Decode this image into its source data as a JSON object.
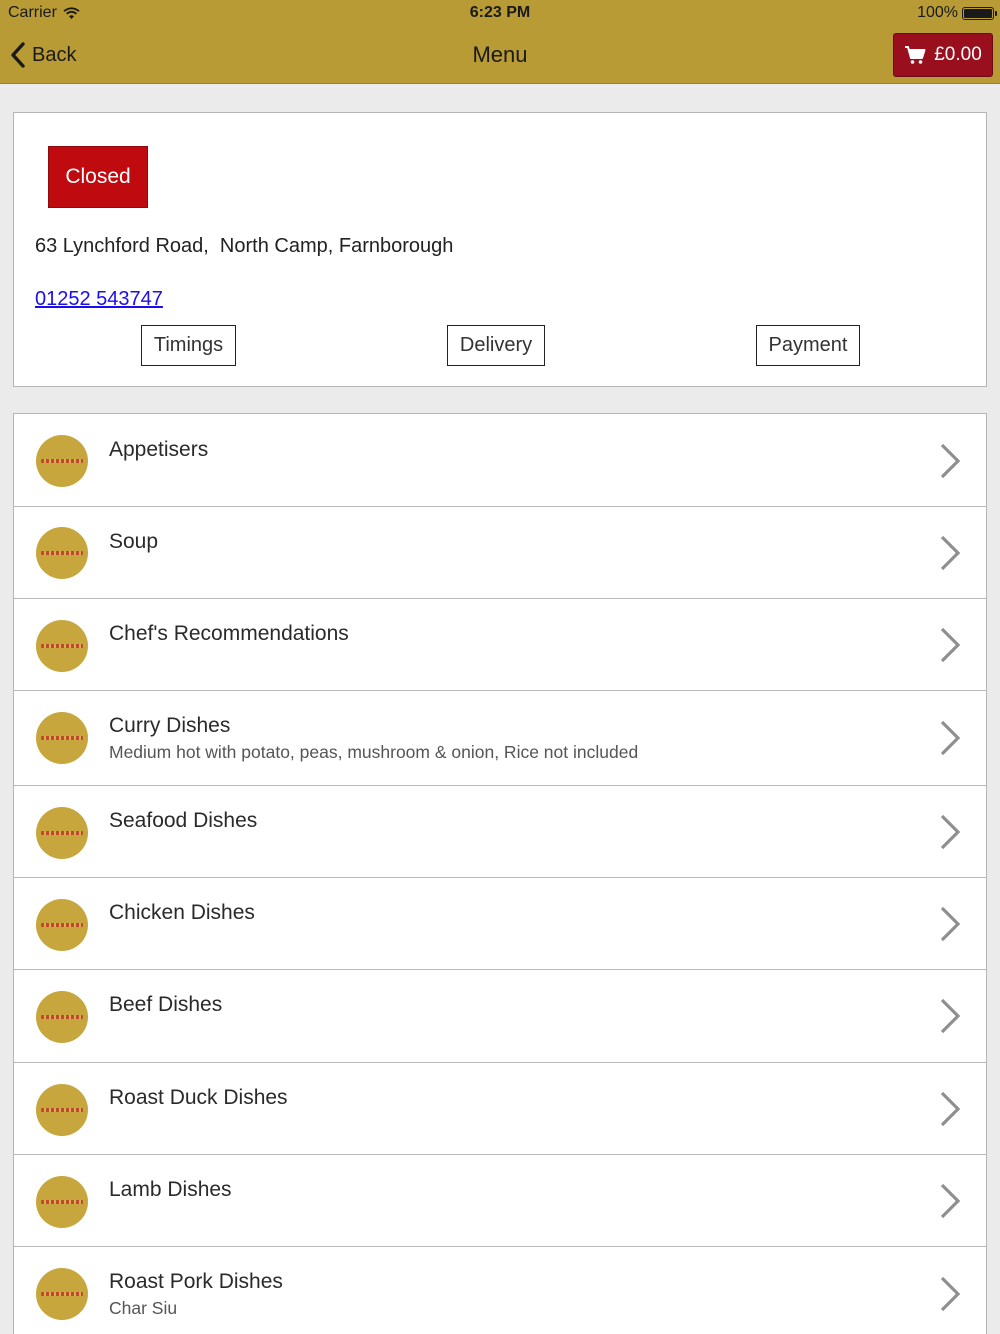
{
  "status_bar": {
    "carrier": "Carrier",
    "time": "6:23 PM",
    "battery": "100%"
  },
  "nav": {
    "back_label": "Back",
    "title": "Menu",
    "cart_total": "£0.00"
  },
  "info": {
    "status_badge": "Closed",
    "address": "63 Lynchford Road,  North Camp, Farnborough",
    "phone": "01252 543747",
    "buttons": {
      "timings": "Timings",
      "delivery": "Delivery",
      "payment": "Payment"
    }
  },
  "colors": {
    "header": "#b89b34",
    "cart": "#9a0f1e",
    "closed": "#bf0a0f",
    "link": "#1a0dee",
    "logo": "#c6a63d"
  },
  "menu": {
    "items": [
      {
        "title": "Appetisers",
        "subtitle": ""
      },
      {
        "title": "Soup",
        "subtitle": ""
      },
      {
        "title": "Chef's Recommendations",
        "subtitle": ""
      },
      {
        "title": "Curry Dishes",
        "subtitle": "Medium hot with potato, peas, mushroom & onion, Rice not included"
      },
      {
        "title": "Seafood Dishes",
        "subtitle": ""
      },
      {
        "title": "Chicken Dishes",
        "subtitle": ""
      },
      {
        "title": "Beef Dishes",
        "subtitle": ""
      },
      {
        "title": "Roast Duck Dishes",
        "subtitle": ""
      },
      {
        "title": "Lamb Dishes",
        "subtitle": ""
      },
      {
        "title": "Roast Pork Dishes",
        "subtitle": "Char Siu"
      }
    ]
  }
}
